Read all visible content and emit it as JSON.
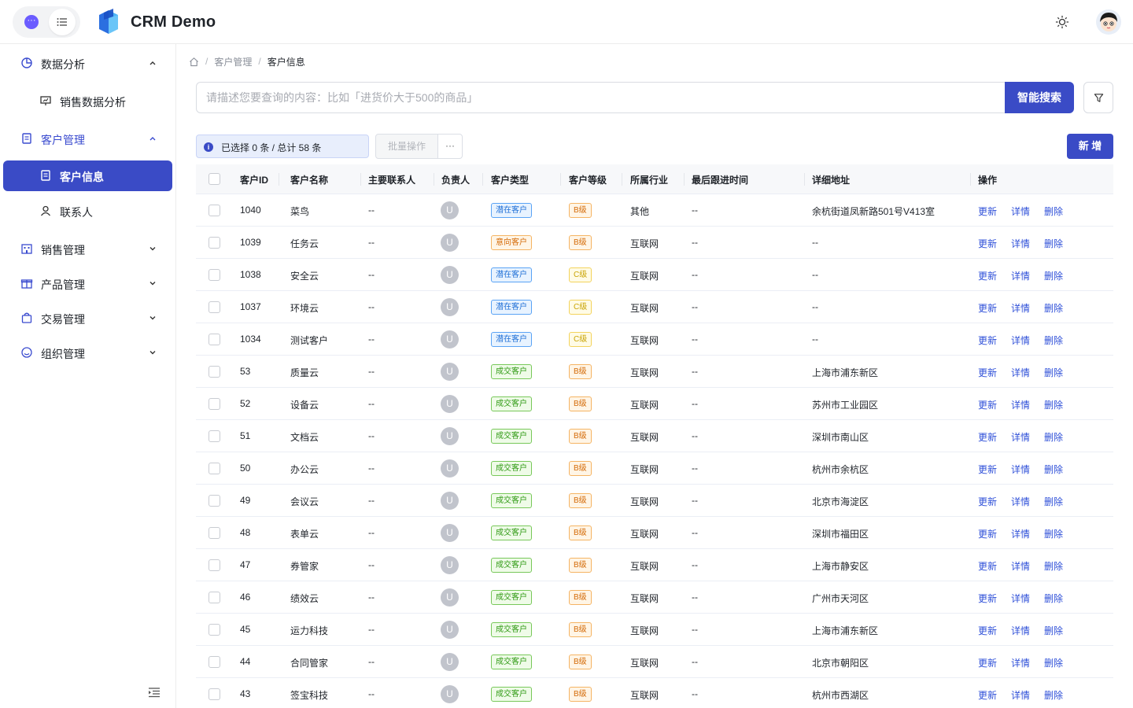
{
  "app": {
    "title": "CRM Demo"
  },
  "sidebar": {
    "items": [
      {
        "label": "数据分析",
        "icon": "pie-chart-icon",
        "state": "expanded"
      },
      {
        "label": "销售数据分析",
        "icon": "presentation-icon",
        "sub": true
      },
      {
        "label": "客户管理",
        "icon": "clipboard-icon",
        "state": "expanded-active"
      },
      {
        "label": "客户信息",
        "icon": "document-icon",
        "sub": true,
        "active": true
      },
      {
        "label": "联系人",
        "icon": "user-icon",
        "sub": true
      },
      {
        "label": "销售管理",
        "icon": "building-icon",
        "state": "collapsed"
      },
      {
        "label": "产品管理",
        "icon": "gift-icon",
        "state": "collapsed"
      },
      {
        "label": "交易管理",
        "icon": "bag-icon",
        "state": "collapsed"
      },
      {
        "label": "组织管理",
        "icon": "smile-icon",
        "state": "collapsed"
      }
    ]
  },
  "breadcrumb": {
    "level1": "客户管理",
    "level2": "客户信息",
    "separator": "/"
  },
  "search": {
    "placeholder": "请描述您要查询的内容：比如「进货价大于500的商品」",
    "button": "智能搜索"
  },
  "toolbar": {
    "selection_text": "已选择 0 条 / 总计 58 条",
    "batch_label": "批量操作",
    "more_label": "···",
    "add_label": "新 增"
  },
  "table": {
    "columns": [
      "客户ID",
      "客户名称",
      "主要联系人",
      "负责人",
      "客户类型",
      "客户等级",
      "所属行业",
      "最后跟进时间",
      "详细地址",
      "操作"
    ],
    "actions": [
      "更新",
      "详情",
      "删除"
    ],
    "owner_initial": "U",
    "rows": [
      {
        "id": "1040",
        "name": "菜鸟",
        "contact": "--",
        "type": "潜在客户",
        "type_style": "blue",
        "level": "B级",
        "level_style": "orange",
        "industry": "其他",
        "last": "--",
        "address": "余杭街道凤新路501号V413室"
      },
      {
        "id": "1039",
        "name": "任务云",
        "contact": "--",
        "type": "意向客户",
        "type_style": "orange",
        "level": "B级",
        "level_style": "orange",
        "industry": "互联网",
        "last": "--",
        "address": "--"
      },
      {
        "id": "1038",
        "name": "安全云",
        "contact": "--",
        "type": "潜在客户",
        "type_style": "blue",
        "level": "C级",
        "level_style": "yellow",
        "industry": "互联网",
        "last": "--",
        "address": "--"
      },
      {
        "id": "1037",
        "name": "环境云",
        "contact": "--",
        "type": "潜在客户",
        "type_style": "blue",
        "level": "C级",
        "level_style": "yellow",
        "industry": "互联网",
        "last": "--",
        "address": "--"
      },
      {
        "id": "1034",
        "name": "测试客户",
        "contact": "--",
        "type": "潜在客户",
        "type_style": "blue",
        "level": "C级",
        "level_style": "yellow",
        "industry": "互联网",
        "last": "--",
        "address": "--"
      },
      {
        "id": "53",
        "name": "质量云",
        "contact": "--",
        "type": "成交客户",
        "type_style": "green",
        "level": "B级",
        "level_style": "orange",
        "industry": "互联网",
        "last": "--",
        "address": "上海市浦东新区"
      },
      {
        "id": "52",
        "name": "设备云",
        "contact": "--",
        "type": "成交客户",
        "type_style": "green",
        "level": "B级",
        "level_style": "orange",
        "industry": "互联网",
        "last": "--",
        "address": "苏州市工业园区"
      },
      {
        "id": "51",
        "name": "文档云",
        "contact": "--",
        "type": "成交客户",
        "type_style": "green",
        "level": "B级",
        "level_style": "orange",
        "industry": "互联网",
        "last": "--",
        "address": "深圳市南山区"
      },
      {
        "id": "50",
        "name": "办公云",
        "contact": "--",
        "type": "成交客户",
        "type_style": "green",
        "level": "B级",
        "level_style": "orange",
        "industry": "互联网",
        "last": "--",
        "address": "杭州市余杭区"
      },
      {
        "id": "49",
        "name": "会议云",
        "contact": "--",
        "type": "成交客户",
        "type_style": "green",
        "level": "B级",
        "level_style": "orange",
        "industry": "互联网",
        "last": "--",
        "address": "北京市海淀区"
      },
      {
        "id": "48",
        "name": "表单云",
        "contact": "--",
        "type": "成交客户",
        "type_style": "green",
        "level": "B级",
        "level_style": "orange",
        "industry": "互联网",
        "last": "--",
        "address": "深圳市福田区"
      },
      {
        "id": "47",
        "name": "券管家",
        "contact": "--",
        "type": "成交客户",
        "type_style": "green",
        "level": "B级",
        "level_style": "orange",
        "industry": "互联网",
        "last": "--",
        "address": "上海市静安区"
      },
      {
        "id": "46",
        "name": "绩效云",
        "contact": "--",
        "type": "成交客户",
        "type_style": "green",
        "level": "B级",
        "level_style": "orange",
        "industry": "互联网",
        "last": "--",
        "address": "广州市天河区"
      },
      {
        "id": "45",
        "name": "运力科技",
        "contact": "--",
        "type": "成交客户",
        "type_style": "green",
        "level": "B级",
        "level_style": "orange",
        "industry": "互联网",
        "last": "--",
        "address": "上海市浦东新区"
      },
      {
        "id": "44",
        "name": "合同管家",
        "contact": "--",
        "type": "成交客户",
        "type_style": "green",
        "level": "B级",
        "level_style": "orange",
        "industry": "互联网",
        "last": "--",
        "address": "北京市朝阳区"
      },
      {
        "id": "43",
        "name": "签宝科技",
        "contact": "--",
        "type": "成交客户",
        "type_style": "green",
        "level": "B级",
        "level_style": "orange",
        "industry": "互联网",
        "last": "--",
        "address": "杭州市西湖区"
      }
    ]
  },
  "colors": {
    "primary": "#3a4bc6",
    "link": "#2e4fd8"
  }
}
